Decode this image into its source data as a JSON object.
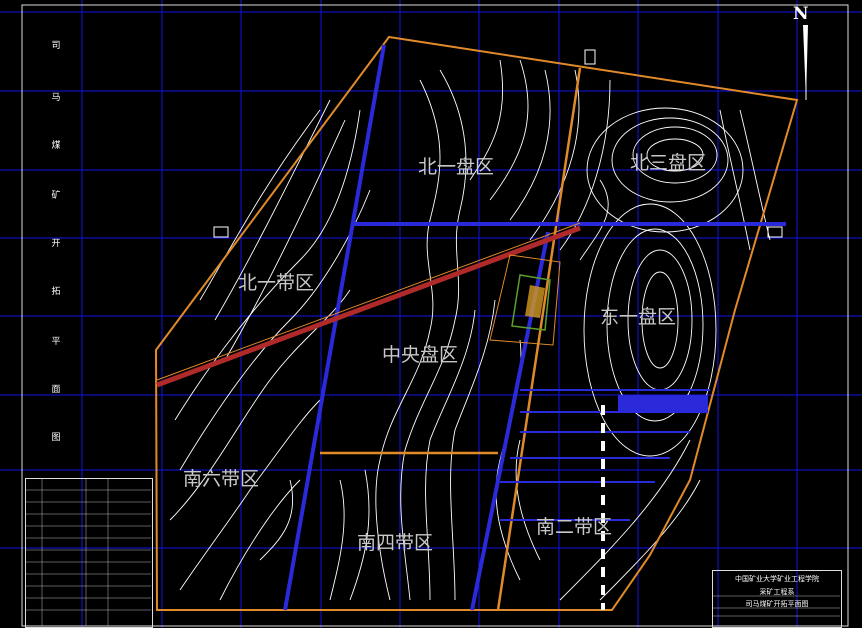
{
  "drawing": {
    "vertical_title": [
      "司",
      "马",
      "煤",
      "矿",
      "开",
      "拓",
      "平",
      "面",
      "图"
    ],
    "north_label": "N",
    "zones": {
      "north_one_panel": "北一盘区",
      "north_three_panel": "北三盘区",
      "north_one_belt": "北一带区",
      "central_panel": "中央盘区",
      "east_one_panel": "东一盘区",
      "south_six_belt": "南六带区",
      "south_four_belt": "南四带区",
      "south_two_belt": "南二带区"
    },
    "title_block": {
      "institution": "中国矿业大学矿业工程学院",
      "project": "采矿工程系",
      "drawing_name": "司马煤矿开拓平面图"
    },
    "colors": {
      "background": "#000000",
      "grid": "#1010e0",
      "contour": "#ffffff",
      "boundary": "#e08a2a",
      "main_roadway": "#2a2adb",
      "inclined_shaft": "#b02a2a",
      "station_box": "#5aa02a"
    }
  }
}
